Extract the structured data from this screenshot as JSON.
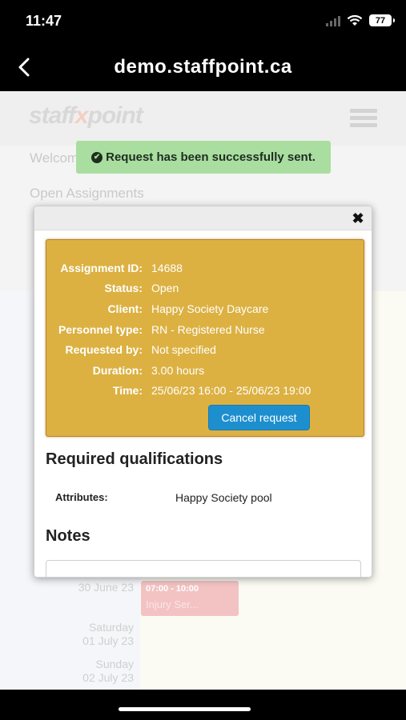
{
  "status_bar": {
    "time": "11:47",
    "battery": "77"
  },
  "browser": {
    "title": "demo.staffpoint.ca"
  },
  "page": {
    "logo_left": "staff",
    "logo_x": "x",
    "logo_right": "point",
    "welcome": "Welcome",
    "open_assignments": "Open Assignments",
    "calendar": [
      {
        "line1": "30 June 23",
        "line2": ""
      },
      {
        "line1": "Saturday",
        "line2": "01 July 23"
      },
      {
        "line1": "Sunday",
        "line2": "02 July 23"
      }
    ],
    "event": {
      "time": "07:00 - 10:00",
      "name": "Injury Ser..."
    }
  },
  "toast": {
    "message": "Request has been successfully sent."
  },
  "modal": {
    "close": "✖",
    "assignment": {
      "rows": [
        {
          "label": "Assignment ID:",
          "value": "14688"
        },
        {
          "label": "Status:",
          "value": "Open"
        },
        {
          "label": "Client:",
          "value": "Happy Society Daycare"
        },
        {
          "label": "Personnel type:",
          "value": "RN - Registered Nurse"
        },
        {
          "label": "Requested by:",
          "value": "Not specified"
        },
        {
          "label": "Duration:",
          "value": "3.00 hours"
        },
        {
          "label": "Time:",
          "value": "25/06/23 16:00 - 25/06/23 19:00"
        }
      ],
      "cancel_label": "Cancel request"
    },
    "qualifications": {
      "heading": "Required qualifications",
      "attr_label": "Attributes:",
      "attr_value": "Happy Society pool"
    },
    "notes": {
      "heading": "Notes"
    }
  },
  "colors": {
    "assignment_bg": "#dcb142",
    "toast_bg": "#a9dea0",
    "button_blue": "#1d8fcf"
  }
}
